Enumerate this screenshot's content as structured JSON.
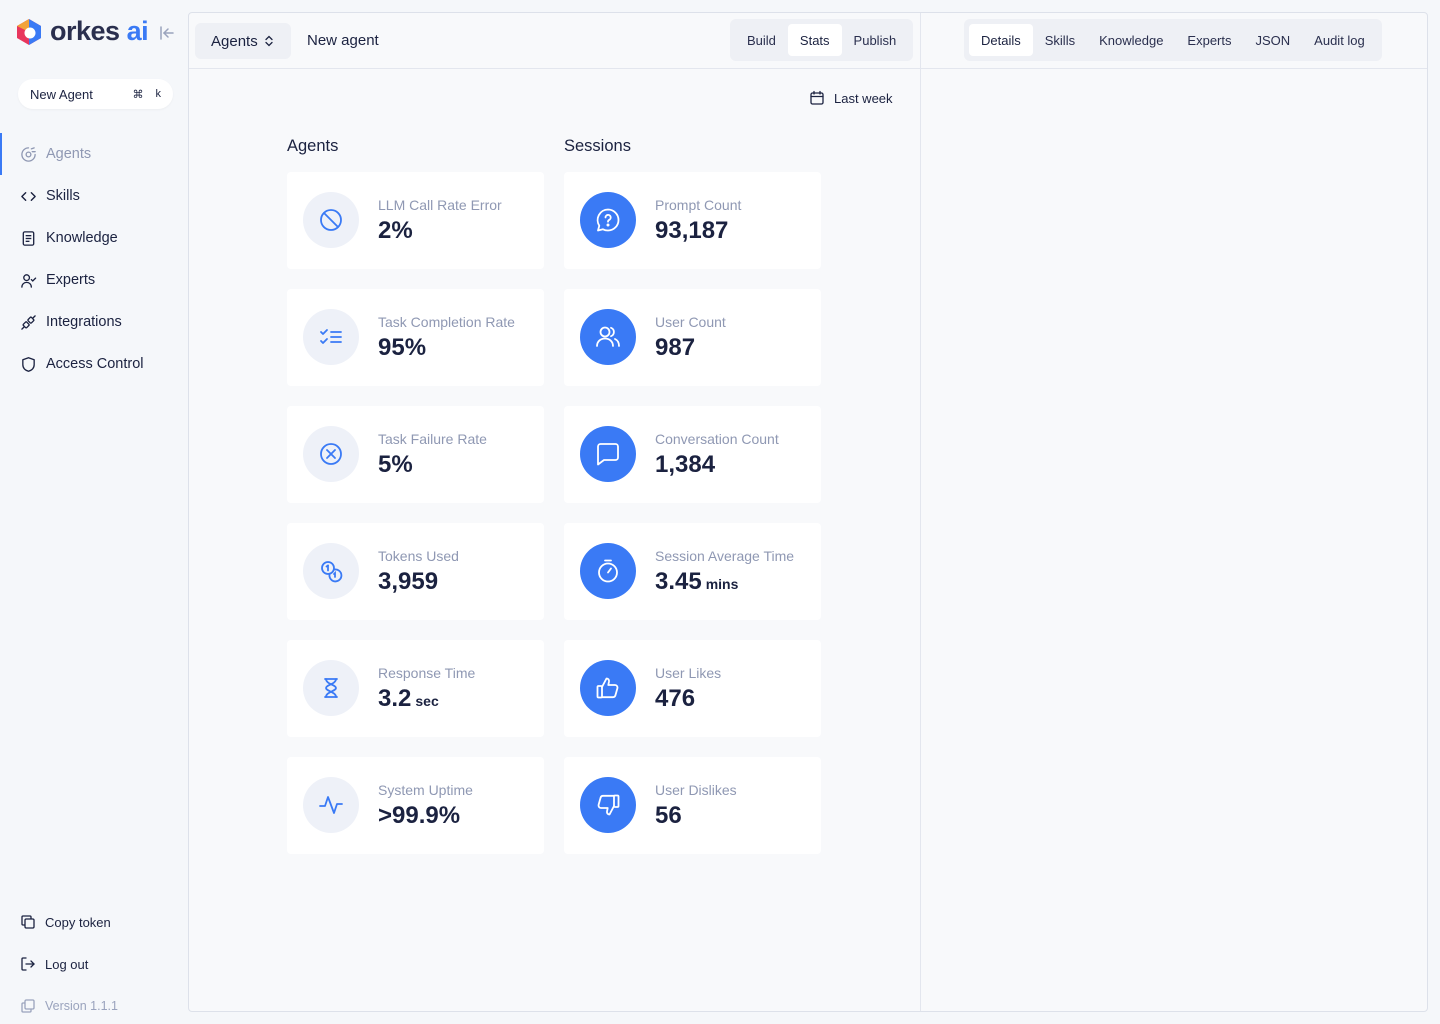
{
  "brand": {
    "name": "orkes",
    "suffix": "ai",
    "accent": "#3a7af5"
  },
  "sidebar": {
    "new_agent_label": "New Agent",
    "shortcut_cmd": "⌘",
    "shortcut_key": "k",
    "items": [
      {
        "label": "Agents",
        "icon": "agents-icon",
        "active": true
      },
      {
        "label": "Skills",
        "icon": "code-icon"
      },
      {
        "label": "Knowledge",
        "icon": "document-icon"
      },
      {
        "label": "Experts",
        "icon": "user-check-icon"
      },
      {
        "label": "Integrations",
        "icon": "plug-icon"
      },
      {
        "label": "Access Control",
        "icon": "shield-icon"
      }
    ],
    "copy_token": "Copy token",
    "log_out": "Log out",
    "version": "Version 1.1.1"
  },
  "header": {
    "selector_label": "Agents",
    "title": "New agent",
    "view_tabs": [
      "Build",
      "Stats",
      "Publish"
    ],
    "active_view": "Stats",
    "panel_tabs": [
      "Details",
      "Skills",
      "Knowledge",
      "Experts",
      "JSON",
      "Audit log"
    ],
    "active_panel": "Details"
  },
  "stats": {
    "date_range": "Last week",
    "agents_title": "Agents",
    "sessions_title": "Sessions",
    "agents": [
      {
        "label": "LLM Call Rate Error",
        "value": "2%",
        "unit": "",
        "icon": "ban-icon"
      },
      {
        "label": "Task Completion Rate",
        "value": "95%",
        "unit": "",
        "icon": "checklist-icon"
      },
      {
        "label": "Task Failure Rate",
        "value": "5%",
        "unit": "",
        "icon": "x-circle-icon"
      },
      {
        "label": "Tokens Used",
        "value": "3,959",
        "unit": "",
        "icon": "coins-icon"
      },
      {
        "label": "Response Time",
        "value": "3.2",
        "unit": "sec",
        "icon": "hourglass-icon"
      },
      {
        "label": "System Uptime",
        "value": ">99.9%",
        "unit": "",
        "icon": "activity-icon"
      }
    ],
    "sessions": [
      {
        "label": "Prompt Count",
        "value": "93,187",
        "unit": "",
        "icon": "message-question-icon"
      },
      {
        "label": "User Count",
        "value": "987",
        "unit": "",
        "icon": "users-icon"
      },
      {
        "label": "Conversation Count",
        "value": "1,384",
        "unit": "",
        "icon": "message-square-icon"
      },
      {
        "label": "Session Average Time",
        "value": "3.45",
        "unit": "mins",
        "icon": "timer-icon"
      },
      {
        "label": "User Likes",
        "value": "476",
        "unit": "",
        "icon": "thumbs-up-icon"
      },
      {
        "label": "User Dislikes",
        "value": "56",
        "unit": "",
        "icon": "thumbs-down-icon"
      }
    ]
  }
}
